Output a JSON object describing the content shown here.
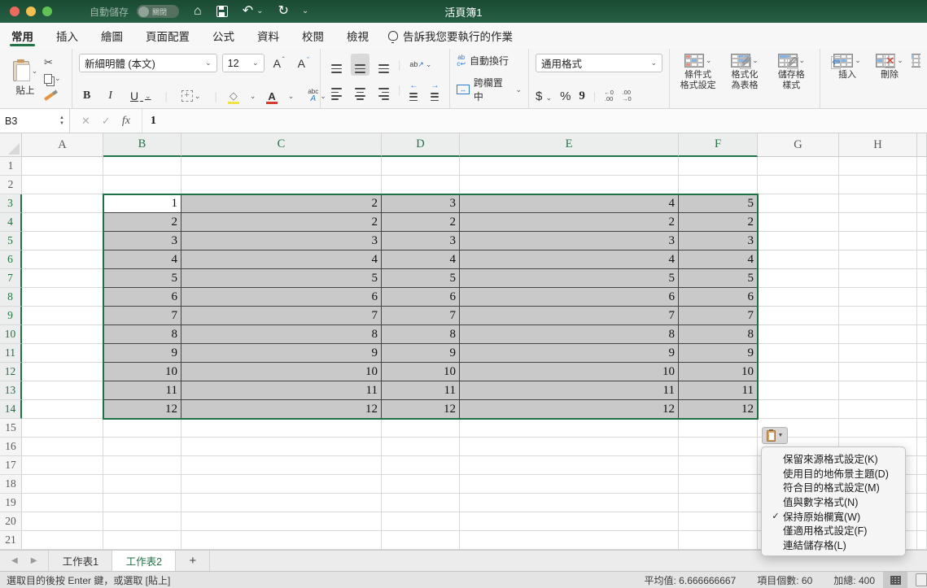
{
  "titlebar": {
    "title": "活頁簿1",
    "autosave_label": "自動儲存",
    "autosave_state": "關閉"
  },
  "ribbon_tabs": [
    {
      "label": "常用",
      "active": true
    },
    {
      "label": "插入",
      "active": false
    },
    {
      "label": "繪圖",
      "active": false
    },
    {
      "label": "頁面配置",
      "active": false
    },
    {
      "label": "公式",
      "active": false
    },
    {
      "label": "資料",
      "active": false
    },
    {
      "label": "校閱",
      "active": false
    },
    {
      "label": "檢視",
      "active": false
    }
  ],
  "tellme_label": "告訴我您要執行的作業",
  "ribbon": {
    "paste": "貼上",
    "font_name": "新細明體 (本文)",
    "font_size": "12",
    "bold": "B",
    "italic": "I",
    "underline": "U",
    "wrap": "自動換行",
    "merge": "跨欄置中",
    "number_format": "通用格式",
    "currency": "$",
    "percent": "%",
    "comma": "9",
    "conditional": "條件式\n格式設定",
    "format_table": "格式化\n為表格",
    "cell_styles": "儲存格\n樣式",
    "insert": "插入",
    "delete": "刪除"
  },
  "formula_bar": {
    "name_box": "B3",
    "fx": "fx",
    "value": "1"
  },
  "grid": {
    "columns": [
      "A",
      "B",
      "C",
      "D",
      "E",
      "F",
      "G",
      "H",
      ""
    ],
    "selected_columns": [
      "B",
      "C",
      "D",
      "E",
      "F"
    ],
    "rows": [
      "1",
      "2",
      "3",
      "4",
      "5",
      "6",
      "7",
      "8",
      "9",
      "10",
      "11",
      "12",
      "13",
      "14",
      "15",
      "16",
      "17",
      "18",
      "19",
      "20",
      "21"
    ],
    "selected_rows": [
      "3",
      "4",
      "5",
      "6",
      "7",
      "8",
      "9",
      "10",
      "11",
      "12",
      "13",
      "14"
    ],
    "active_cell": "B3",
    "data_columns": [
      "B",
      "C",
      "D",
      "E",
      "F"
    ],
    "data": {
      "3": [
        "1",
        "2",
        "3",
        "4",
        "5"
      ],
      "4": [
        "2",
        "2",
        "2",
        "2",
        "2"
      ],
      "5": [
        "3",
        "3",
        "3",
        "3",
        "3"
      ],
      "6": [
        "4",
        "4",
        "4",
        "4",
        "4"
      ],
      "7": [
        "5",
        "5",
        "5",
        "5",
        "5"
      ],
      "8": [
        "6",
        "6",
        "6",
        "6",
        "6"
      ],
      "9": [
        "7",
        "7",
        "7",
        "7",
        "7"
      ],
      "10": [
        "8",
        "8",
        "8",
        "8",
        "8"
      ],
      "11": [
        "9",
        "9",
        "9",
        "9",
        "9"
      ],
      "12": [
        "10",
        "10",
        "10",
        "10",
        "10"
      ],
      "13": [
        "11",
        "11",
        "11",
        "11",
        "11"
      ],
      "14": [
        "12",
        "12",
        "12",
        "12",
        "12"
      ]
    }
  },
  "paste_menu": {
    "items": [
      {
        "label": "保留來源格式設定(K)",
        "checked": false
      },
      {
        "label": "使用目的地佈景主題(D)",
        "checked": false
      },
      {
        "label": "符合目的格式設定(M)",
        "checked": false
      },
      {
        "label": "值與數字格式(N)",
        "checked": false
      },
      {
        "label": "保持原始欄寬(W)",
        "checked": true
      },
      {
        "label": "僅適用格式設定(F)",
        "checked": false
      },
      {
        "label": "連結儲存格(L)",
        "checked": false
      }
    ]
  },
  "sheet_tabs": [
    {
      "label": "工作表1",
      "active": false
    },
    {
      "label": "工作表2",
      "active": true
    }
  ],
  "add_sheet_label": "+",
  "status_bar": {
    "message": "選取目的後按 Enter 鍵，或選取 [貼上]",
    "average": "平均值: 6.666666667",
    "count": "項目個數: 60",
    "sum": "加總: 400"
  },
  "colors": {
    "accent_green": "#217346",
    "selection_fill": "#c9c9c9",
    "titlebar_green": "#266044"
  }
}
